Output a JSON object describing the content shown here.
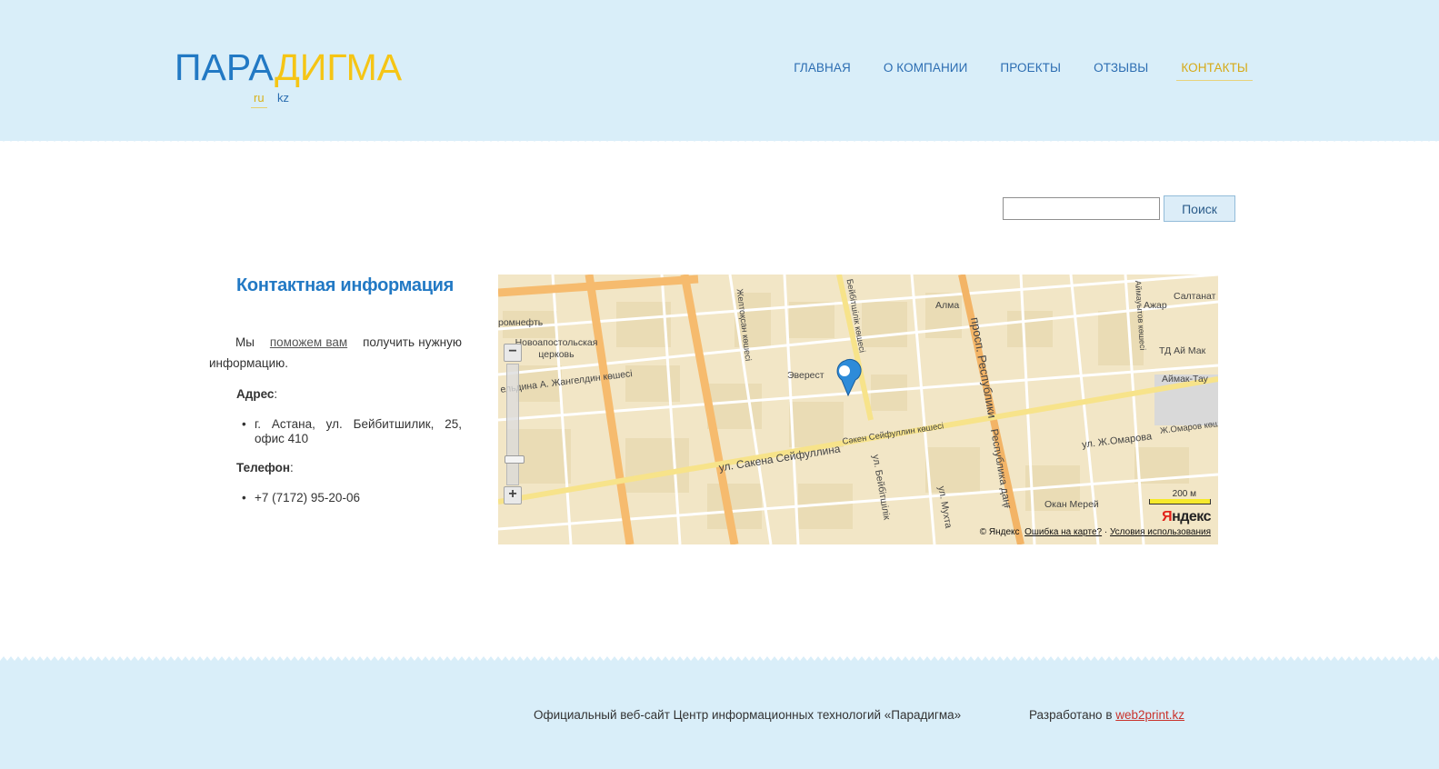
{
  "header": {
    "logo_part1": "ПАРА",
    "logo_part2": "ДИГМА",
    "languages": [
      {
        "code": "ru",
        "active": true
      },
      {
        "code": "kz",
        "active": false
      }
    ],
    "nav": [
      {
        "label": "ГЛАВНАЯ",
        "active": false
      },
      {
        "label": "О КОМПАНИИ",
        "active": false
      },
      {
        "label": "ПРОЕКТЫ",
        "active": false
      },
      {
        "label": "ОТЗЫВЫ",
        "active": false
      },
      {
        "label": "КОНТАКТЫ",
        "active": true
      }
    ]
  },
  "search": {
    "value": "",
    "button_label": "Поиск"
  },
  "contact": {
    "title": "Контактная информация",
    "intro_before": "Мы",
    "intro_link": "поможем вам",
    "intro_after": "получить нужную информацию.",
    "address_label": "Адрес",
    "address_value": "г. Астана, ул. Бейбитшилик, 25, офис 410",
    "phone_label": "Телефон",
    "phone_value": "+7 (7172) 95-20-06"
  },
  "map": {
    "labels": {
      "kaz_neft": "ромнефть",
      "church": "Новоапостольская церковь",
      "zhangeldin": "ельдина А. Жангелдин көшесі",
      "everest": "Эверест",
      "alma": "Алма",
      "azhar": "Ажар",
      "saltanat": "Салтанат",
      "td_ai_mak": "ТД Ай Мак",
      "aimak_tau": "Аймак-Тау",
      "seifullin": "ул. Сакена Сейфуллина",
      "seifullin_kz": "Сәкен Сейфуллин көшесі",
      "beibit_kz": "Бейбітшілік көшесі",
      "beibit_ru": "ул. Бейбітшілік",
      "zheltoksan": "Желтоқсан көшесі",
      "respublika": "просп. Республики",
      "respublika_kz": "Республика даңғ",
      "omarova": "ул. Ж.Омарова",
      "omarov_kz": "Ж.Омаров көш",
      "okan": "Окан Мерей",
      "mukh": "ул. Мухта",
      "aimautov": "Аймауытов көшесі"
    },
    "scale": "200 м",
    "logo_ya": "Я",
    "logo_rest": "ндекс",
    "copyright": "© Яндекс",
    "error_link": "Ошибка на карте?",
    "terms_link": "Условия использования"
  },
  "footer": {
    "official": "Официальный веб-сайт Центр информационных технологий «Парадигма»",
    "developed_prefix": "Разработано в",
    "developed_link": "web2print.kz"
  }
}
